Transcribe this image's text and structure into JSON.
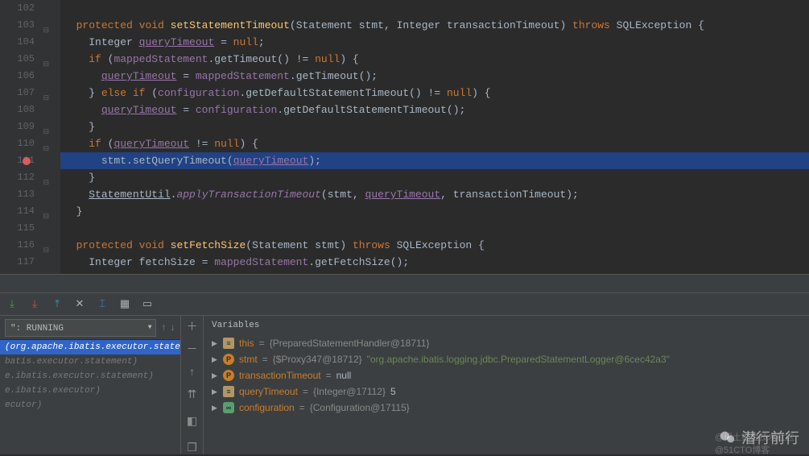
{
  "editor": {
    "lines": [
      {
        "n": 102,
        "content": ""
      },
      {
        "n": 103,
        "fold": "open",
        "indent": "  ",
        "tokens": [
          [
            "protected",
            "kw-access"
          ],
          [
            " ",
            "p"
          ],
          [
            "void",
            "kw-access"
          ],
          [
            " ",
            "p"
          ],
          [
            "setStatementTimeout",
            "method-decl"
          ],
          [
            "(",
            "p"
          ],
          [
            "Statement",
            "kw-type"
          ],
          [
            " ",
            "p"
          ],
          [
            "stmt",
            "param"
          ],
          [
            ", ",
            "p"
          ],
          [
            "Integer",
            "kw-type"
          ],
          [
            " ",
            "p"
          ],
          [
            "transactionTimeout",
            "param"
          ],
          [
            ") ",
            "p"
          ],
          [
            "throws",
            "kw-access"
          ],
          [
            " ",
            "p"
          ],
          [
            "SQLException",
            "kw-type"
          ],
          [
            " {",
            "p"
          ]
        ]
      },
      {
        "n": 104,
        "indent": "    ",
        "tokens": [
          [
            "Integer",
            "kw-type"
          ],
          [
            " ",
            "p"
          ],
          [
            "queryTimeout",
            "annot"
          ],
          [
            " = ",
            "p"
          ],
          [
            "null",
            "literal-null"
          ],
          [
            ";",
            "p"
          ]
        ]
      },
      {
        "n": 105,
        "fold": "open",
        "indent": "    ",
        "tokens": [
          [
            "if",
            "kw-control"
          ],
          [
            " (",
            "p"
          ],
          [
            "mappedStatement",
            "field"
          ],
          [
            ".",
            "p"
          ],
          [
            "getTimeout",
            "ident"
          ],
          [
            "() != ",
            "p"
          ],
          [
            "null",
            "literal-null"
          ],
          [
            ") {",
            "p"
          ]
        ]
      },
      {
        "n": 106,
        "indent": "      ",
        "tokens": [
          [
            "queryTimeout",
            "annot"
          ],
          [
            " = ",
            "p"
          ],
          [
            "mappedStatement",
            "field"
          ],
          [
            ".",
            "p"
          ],
          [
            "getTimeout",
            "ident"
          ],
          [
            "();",
            "p"
          ]
        ]
      },
      {
        "n": 107,
        "fold": "open",
        "indent": "    ",
        "tokens": [
          [
            "} ",
            "p"
          ],
          [
            "else if",
            "kw-control"
          ],
          [
            " (",
            "p"
          ],
          [
            "configuration",
            "field"
          ],
          [
            ".",
            "p"
          ],
          [
            "getDefaultStatementTimeout",
            "ident"
          ],
          [
            "() != ",
            "p"
          ],
          [
            "null",
            "literal-null"
          ],
          [
            ") {",
            "p"
          ]
        ]
      },
      {
        "n": 108,
        "indent": "      ",
        "tokens": [
          [
            "queryTimeout",
            "annot"
          ],
          [
            " = ",
            "p"
          ],
          [
            "configuration",
            "field"
          ],
          [
            ".",
            "p"
          ],
          [
            "getDefaultStatementTimeout",
            "ident"
          ],
          [
            "();",
            "p"
          ]
        ]
      },
      {
        "n": 109,
        "fold": "close",
        "indent": "    ",
        "tokens": [
          [
            "}",
            "p"
          ]
        ]
      },
      {
        "n": 110,
        "fold": "open",
        "indent": "    ",
        "tokens": [
          [
            "if",
            "kw-control"
          ],
          [
            " (",
            "p"
          ],
          [
            "queryTimeout",
            "annot"
          ],
          [
            " != ",
            "p"
          ],
          [
            "null",
            "literal-null"
          ],
          [
            ") {",
            "p"
          ]
        ]
      },
      {
        "n": 111,
        "breakpoint": true,
        "highlight": true,
        "indent": "      ",
        "tokens": [
          [
            "stmt",
            "ident"
          ],
          [
            ".",
            "p"
          ],
          [
            "setQueryTimeout",
            "ident"
          ],
          [
            "(",
            "p"
          ],
          [
            "queryTimeout",
            "annot"
          ],
          [
            ");",
            "p"
          ]
        ]
      },
      {
        "n": 112,
        "fold": "close",
        "indent": "    ",
        "tokens": [
          [
            "}",
            "p"
          ]
        ]
      },
      {
        "n": 113,
        "indent": "    ",
        "tokens": [
          [
            "StatementUtil",
            "static-class"
          ],
          [
            ".",
            "p"
          ],
          [
            "applyTransactionTimeout",
            "italic-call"
          ],
          [
            "(",
            "p"
          ],
          [
            "stmt",
            "ident"
          ],
          [
            ", ",
            "p"
          ],
          [
            "queryTimeout",
            "annot"
          ],
          [
            ", ",
            "p"
          ],
          [
            "transactionTimeout",
            "ident"
          ],
          [
            ");",
            "p"
          ]
        ]
      },
      {
        "n": 114,
        "fold": "close",
        "indent": "  ",
        "tokens": [
          [
            "}",
            "p"
          ]
        ]
      },
      {
        "n": 115,
        "content": ""
      },
      {
        "n": 116,
        "fold": "open",
        "indent": "  ",
        "tokens": [
          [
            "protected",
            "kw-access"
          ],
          [
            " ",
            "p"
          ],
          [
            "void",
            "kw-access"
          ],
          [
            " ",
            "p"
          ],
          [
            "setFetchSize",
            "method-decl"
          ],
          [
            "(",
            "p"
          ],
          [
            "Statement",
            "kw-type"
          ],
          [
            " ",
            "p"
          ],
          [
            "stmt",
            "param"
          ],
          [
            ") ",
            "p"
          ],
          [
            "throws",
            "kw-access"
          ],
          [
            " ",
            "p"
          ],
          [
            "SQLException",
            "kw-type"
          ],
          [
            " {",
            "p"
          ]
        ]
      },
      {
        "n": 117,
        "indent": "    ",
        "tokens": [
          [
            "Integer",
            "kw-type"
          ],
          [
            " ",
            "p"
          ],
          [
            "fetchSize",
            "ident"
          ],
          [
            " = ",
            "p"
          ],
          [
            "mappedStatement",
            "field"
          ],
          [
            ".",
            "p"
          ],
          [
            "getFetchSize",
            "ident"
          ],
          [
            "();",
            "p"
          ]
        ]
      }
    ]
  },
  "toolbar": {
    "icons": [
      "download-in",
      "download-out",
      "upload",
      "disconnect",
      "cursor-text",
      "table",
      "grid-off"
    ]
  },
  "frames": {
    "thread_label": "\": RUNNING",
    "items": [
      {
        "text": "(org.apache.ibatis.executor.statement)",
        "selected": true
      },
      {
        "text": "batis.executor.statement)"
      },
      {
        "text": "e.ibatis.executor.statement)"
      },
      {
        "text": "e.ibatis.executor)"
      },
      {
        "text": "ecutor)"
      }
    ]
  },
  "mid_icons": [
    "plus",
    "minus",
    "up",
    "up2",
    "bookmark",
    "copy"
  ],
  "variables": {
    "title": "Variables",
    "rows": [
      {
        "icon": "e",
        "name": "this",
        "eq": " = ",
        "dim": "{PreparedStatementHandler@18711}"
      },
      {
        "icon": "p",
        "name": "stmt",
        "eq": " = ",
        "dim": "{$Proxy347@18712} ",
        "str": "\"org.apache.ibatis.logging.jdbc.PreparedStatementLogger@6cec42a3\""
      },
      {
        "icon": "p",
        "name": "transactionTimeout",
        "eq": " = ",
        "lit": "null"
      },
      {
        "icon": "e",
        "name": "queryTimeout",
        "eq": " = ",
        "dim": "{Integer@17112} ",
        "lit": "5"
      },
      {
        "icon": "link",
        "name": "configuration",
        "eq": " = ",
        "dim": "{Configuration@17115}"
      }
    ]
  },
  "watermark": {
    "main": "潜行前行",
    "sub1": "@稀土掘金技术社区",
    "sub2": "@51CTO博客"
  }
}
